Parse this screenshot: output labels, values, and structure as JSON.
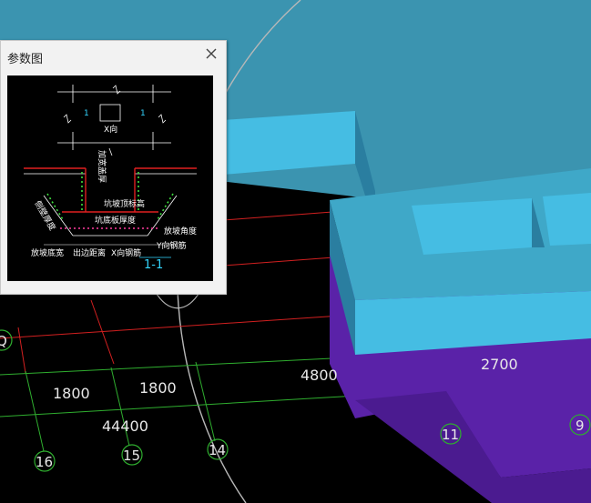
{
  "panel": {
    "title": "参数图",
    "diagram": {
      "x_dir": "X向",
      "y_dir": "Y向",
      "section_mark": "1",
      "section_title": "1-1",
      "labels": {
        "top_outer_width": "加宽盖厚",
        "slope_top_offset": "坑坡顶标高",
        "bottom_thickness": "坑底板厚度",
        "slope_angle": "放坡角度",
        "y_rebar": "Y向钢筋",
        "x_rebar": "X向钢筋",
        "slope_bottom_width": "放坡底宽",
        "edge_distance": "出边距离",
        "wall_thickness": "侧壁厚度"
      }
    }
  },
  "dimensions": {
    "d1": "1800",
    "d2": "1800",
    "d3": "4800",
    "d4": "2700",
    "total": "44400"
  },
  "axes": {
    "a16": "16",
    "a15": "15",
    "a14": "14",
    "a11": "11",
    "a9": "9",
    "aQ": "Q"
  },
  "colors": {
    "background": "#000000",
    "slab_top": "#45bde3",
    "slab_side": "#2a7ea0",
    "pit": "#5a22a8",
    "sky": "#3b94b0",
    "grid_green": "#2fae2f",
    "grid_red": "#d22020"
  }
}
